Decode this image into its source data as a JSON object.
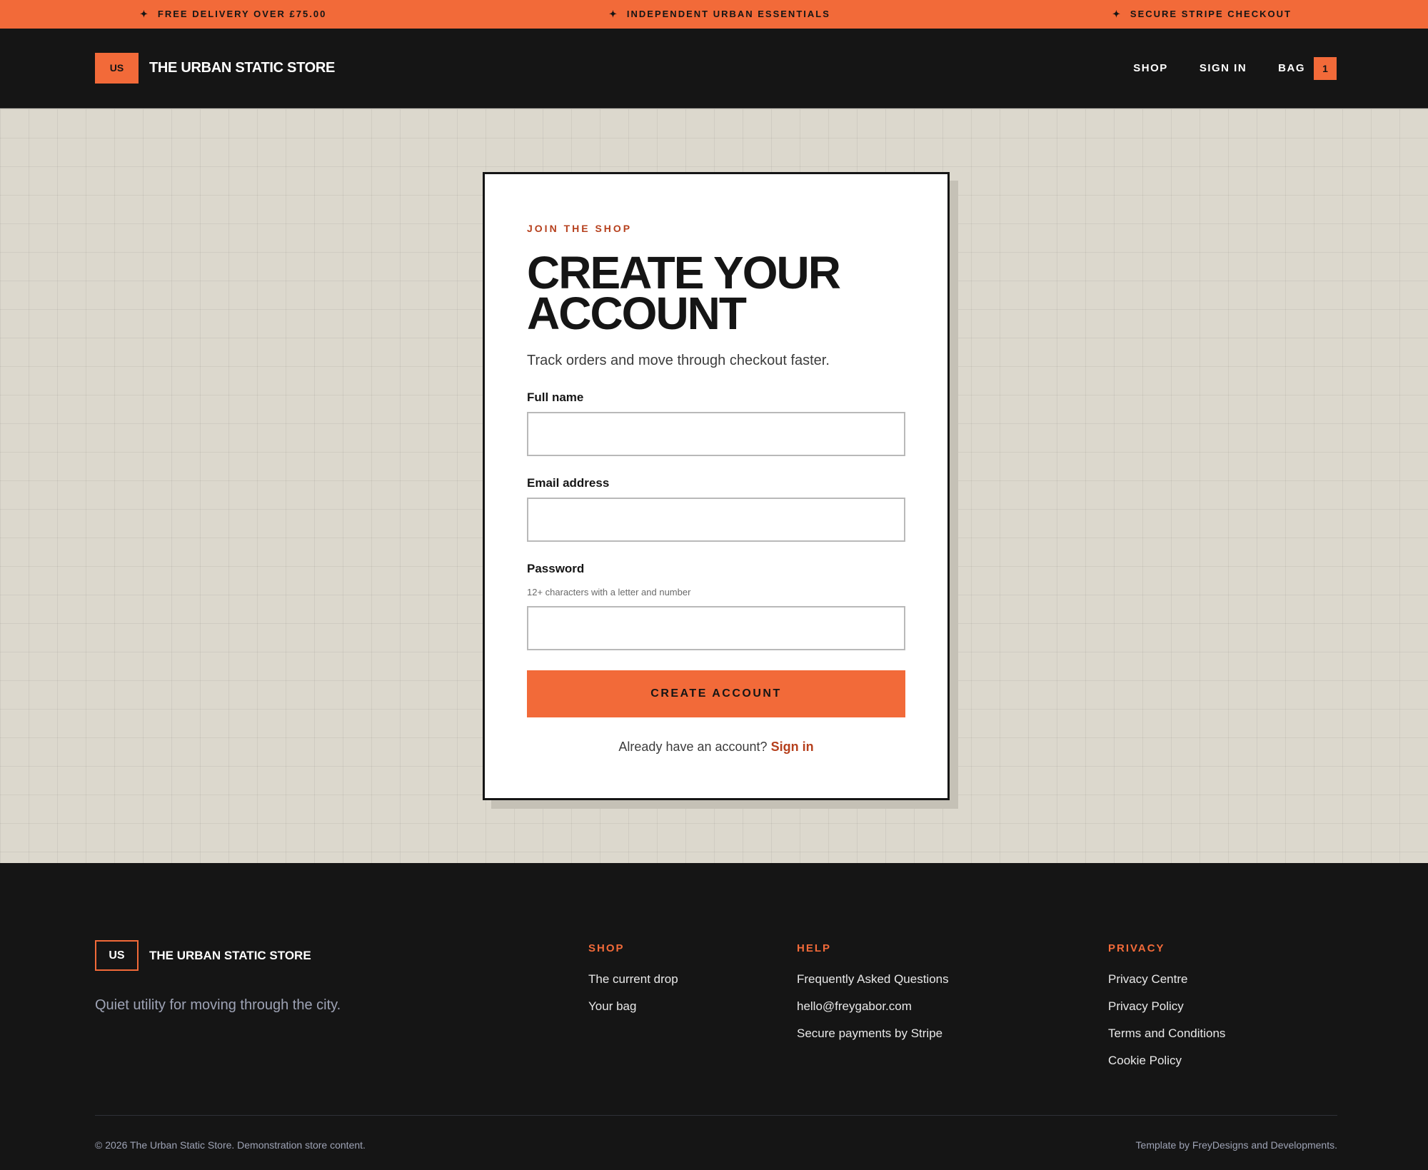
{
  "announcement": {
    "star_icon": "✦",
    "items": [
      "FREE DELIVERY OVER £75.00",
      "INDEPENDENT URBAN ESSENTIALS",
      "SECURE STRIPE CHECKOUT"
    ]
  },
  "header": {
    "logo_mark": "US",
    "logo_text": "THE URBAN STATIC STORE",
    "nav": {
      "shop": "SHOP",
      "sign_in": "SIGN IN",
      "bag": "BAG",
      "bag_count": "1"
    }
  },
  "form": {
    "eyebrow": "JOIN THE SHOP",
    "title": "CREATE YOUR ACCOUNT",
    "subtitle": "Track orders and move through checkout faster.",
    "full_name": {
      "label": "Full name",
      "value": ""
    },
    "email": {
      "label": "Email address",
      "value": ""
    },
    "password": {
      "label": "Password",
      "hint": "12+ characters with a letter and number",
      "value": ""
    },
    "submit_label": "CREATE ACCOUNT",
    "signin_prompt": "Already have an account?",
    "signin_link": "Sign in"
  },
  "footer": {
    "logo_mark": "US",
    "logo_text": "THE URBAN STATIC STORE",
    "tagline": "Quiet utility for moving through the city.",
    "columns": [
      {
        "title": "SHOP",
        "links": [
          "The current drop",
          "Your bag"
        ]
      },
      {
        "title": "HELP",
        "links": [
          "Frequently Asked Questions",
          "hello@freygabor.com",
          "Secure payments by Stripe"
        ]
      },
      {
        "title": "PRIVACY",
        "links": [
          "Privacy Centre",
          "Privacy Policy",
          "Terms and Conditions",
          "Cookie Policy"
        ]
      }
    ],
    "copyright": "© 2026 The Urban Static Store. Demonstration store content.",
    "credit": "Template by FreyDesigns and Developments."
  },
  "colors": {
    "accent": "#f26a39",
    "dark": "#151515",
    "background": "#dcd8cd",
    "link_accent": "#b6401d"
  }
}
